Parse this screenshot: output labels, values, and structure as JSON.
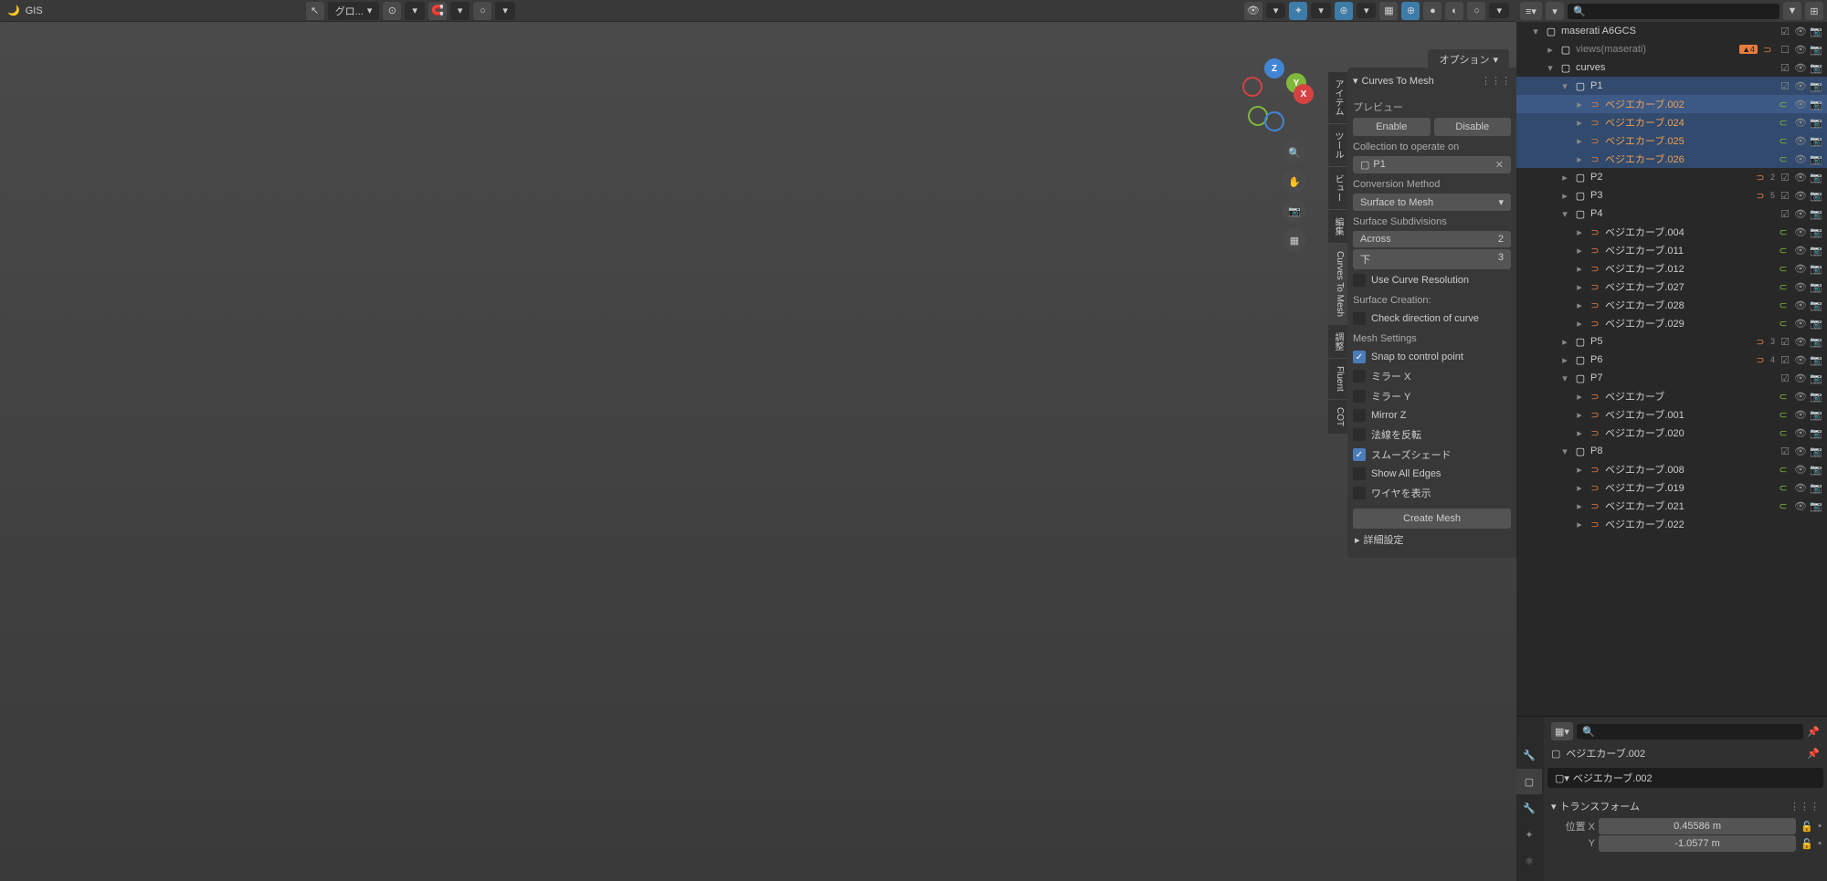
{
  "header": {
    "gis_label": "GIS",
    "transform_mode": "グロ...",
    "options_label": "オプション"
  },
  "panel": {
    "title": "Curves To Mesh",
    "preview_label": "プレビュー",
    "enable_label": "Enable",
    "disable_label": "Disable",
    "collection_label": "Collection to operate on",
    "collection_value": "P1",
    "conversion_label": "Conversion Method",
    "conversion_value": "Surface to Mesh",
    "subdivisions_label": "Surface Subdivisions",
    "across_label": "Across",
    "across_value": "2",
    "down_label": "下",
    "down_value": "3",
    "use_curve_res": "Use Curve Resolution",
    "surface_creation": "Surface Creation:",
    "check_direction": "Check direction of curve",
    "mesh_settings": "Mesh Settings",
    "snap_control": "Snap to control point",
    "mirror_x": "ミラー X",
    "mirror_y": "ミラー Y",
    "mirror_z": "Mirror Z",
    "flip_normals": "法線を反転",
    "smooth_shade": "スムーズシェード",
    "show_edges": "Show All Edges",
    "show_wire": "ワイヤを表示",
    "create_mesh": "Create Mesh",
    "detail_settings": "詳細設定"
  },
  "side_tabs": [
    "アイテム",
    "ツール",
    "ビュー",
    "編集",
    "Curves To Mesh",
    "調整",
    "Fluent",
    "COT"
  ],
  "outliner": {
    "collection_root": "maserati A6GCS",
    "views": "views(maserati)",
    "views_badge": "4",
    "curves": "curves",
    "items": {
      "p1": "P1",
      "p2": "P2",
      "p3": "P3",
      "p4": "P4",
      "p5": "P5",
      "p6": "P6",
      "p7": "P7",
      "p8": "P8",
      "p2_count": "2",
      "p3_count": "5",
      "p5_count": "3",
      "p6_count": "4",
      "bc002": "ベジエカーブ.002",
      "bc024": "ベジエカーブ.024",
      "bc025": "ベジエカーブ.025",
      "bc026": "ベジエカーブ.026",
      "bc004": "ベジエカーブ.004",
      "bc011": "ベジエカーブ.011",
      "bc012": "ベジエカーブ.012",
      "bc027": "ベジエカーブ.027",
      "bc028": "ベジエカーブ.028",
      "bc029": "ベジエカーブ.029",
      "bc": "ベジエカーブ",
      "bc001": "ベジエカーブ.001",
      "bc020": "ベジエカーブ.020",
      "bc008": "ベジエカーブ.008",
      "bc019": "ベジエカーブ.019",
      "bc021": "ベジエカーブ.021",
      "bc022": "ベジエカーブ.022"
    }
  },
  "properties": {
    "object_name": "ベジエカーブ.002",
    "data_name": "ベジエカーブ.002",
    "transform_label": "トランスフォーム",
    "pos_x_label": "位置 X",
    "pos_x": "0.45586 m",
    "pos_y_label": "Y",
    "pos_y": "-1.0577 m"
  }
}
